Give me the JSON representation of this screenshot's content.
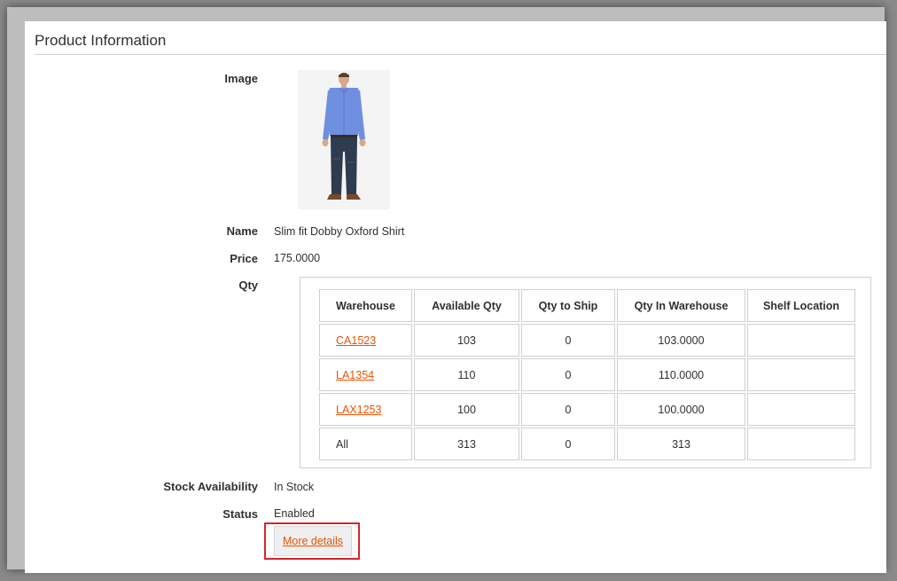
{
  "section": {
    "title": "Product Information"
  },
  "labels": {
    "image": "Image",
    "name": "Name",
    "price": "Price",
    "qty": "Qty",
    "stock": "Stock Availability",
    "status": "Status"
  },
  "product": {
    "name": "Slim fit Dobby Oxford Shirt",
    "price": "175.0000",
    "stock": "In Stock",
    "status": "Enabled",
    "image_colors": {
      "shirt": "#6f8fe0",
      "jeans": "#2f3b4e",
      "skin": "#d9a888",
      "shoes": "#7a4a2a"
    }
  },
  "qty_table": {
    "headers": [
      "Warehouse",
      "Available Qty",
      "Qty to Ship",
      "Qty In Warehouse",
      "Shelf Location"
    ],
    "rows": [
      {
        "warehouse": "CA1523",
        "available": "103",
        "to_ship": "0",
        "in_warehouse": "103.0000",
        "shelf": ""
      },
      {
        "warehouse": "LA1354",
        "available": "110",
        "to_ship": "0",
        "in_warehouse": "110.0000",
        "shelf": ""
      },
      {
        "warehouse": "LAX1253",
        "available": "100",
        "to_ship": "0",
        "in_warehouse": "100.0000",
        "shelf": ""
      },
      {
        "warehouse": "All",
        "available": "313",
        "to_ship": "0",
        "in_warehouse": "313",
        "shelf": ""
      }
    ]
  },
  "more_details": {
    "label": "More details"
  },
  "colors": {
    "link": "#eb5202",
    "highlight": "#d3262a"
  }
}
